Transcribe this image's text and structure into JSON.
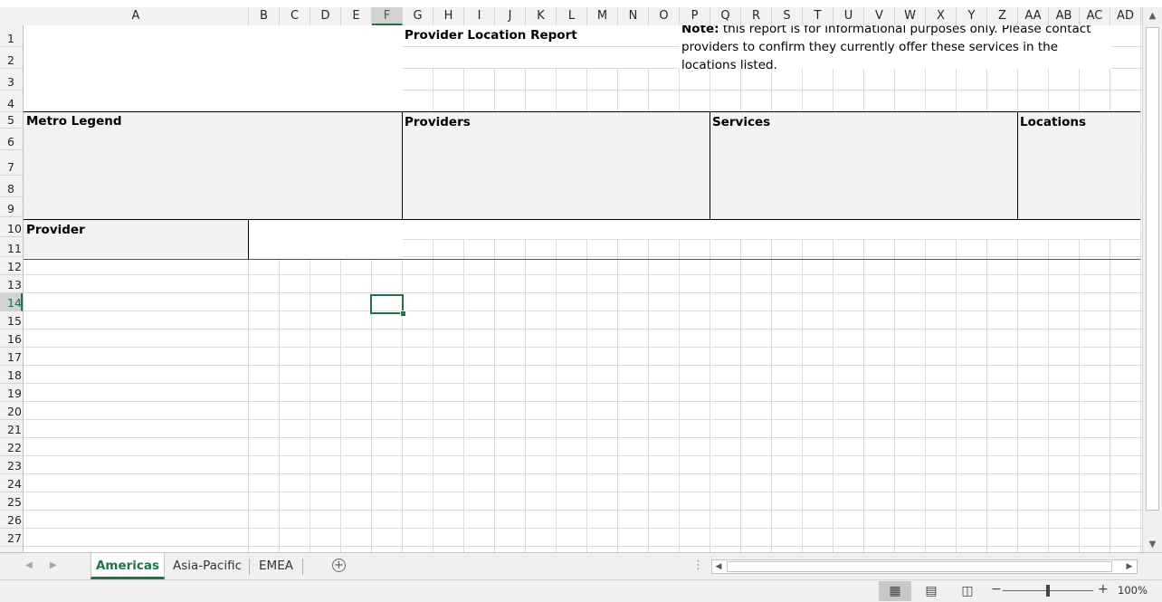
{
  "columns": [
    "A",
    "B",
    "C",
    "D",
    "E",
    "F",
    "G",
    "H",
    "I",
    "J",
    "K",
    "L",
    "M",
    "N",
    "O",
    "P",
    "Q",
    "R",
    "S",
    "T",
    "U",
    "V",
    "W",
    "X",
    "Y",
    "Z",
    "AA",
    "AB",
    "AC",
    "AD"
  ],
  "active_column": "F",
  "rows": [
    "1",
    "2",
    "3",
    "4",
    "5",
    "6",
    "7",
    "8",
    "9",
    "10",
    "11",
    "12",
    "13",
    "14",
    "15",
    "16",
    "17",
    "18",
    "19",
    "20",
    "21",
    "22",
    "23",
    "24",
    "25",
    "26",
    "27"
  ],
  "active_row": "14",
  "report": {
    "title": "Provider Location Report",
    "note_label": "Note:",
    "note_text": " this report is for informational purposes only. Please contact providers to confirm they currently offer these services in the locations listed."
  },
  "sections": {
    "metro_legend": "Metro Legend",
    "providers": "Providers",
    "services": "Services",
    "locations": "Locations",
    "provider": "Provider"
  },
  "sheet_tabs": [
    "Americas",
    "Asia-Pacific",
    "EMEA"
  ],
  "active_sheet": "Americas",
  "zoom": "100%",
  "icons": {
    "add_sheet": "plus-circle-icon",
    "normal_view": "grid-icon",
    "page_layout": "page-icon",
    "page_break": "page-break-icon"
  },
  "colors": {
    "accent": "#217346",
    "header_fill": "#f2f2f2",
    "gridline": "#dadada"
  }
}
